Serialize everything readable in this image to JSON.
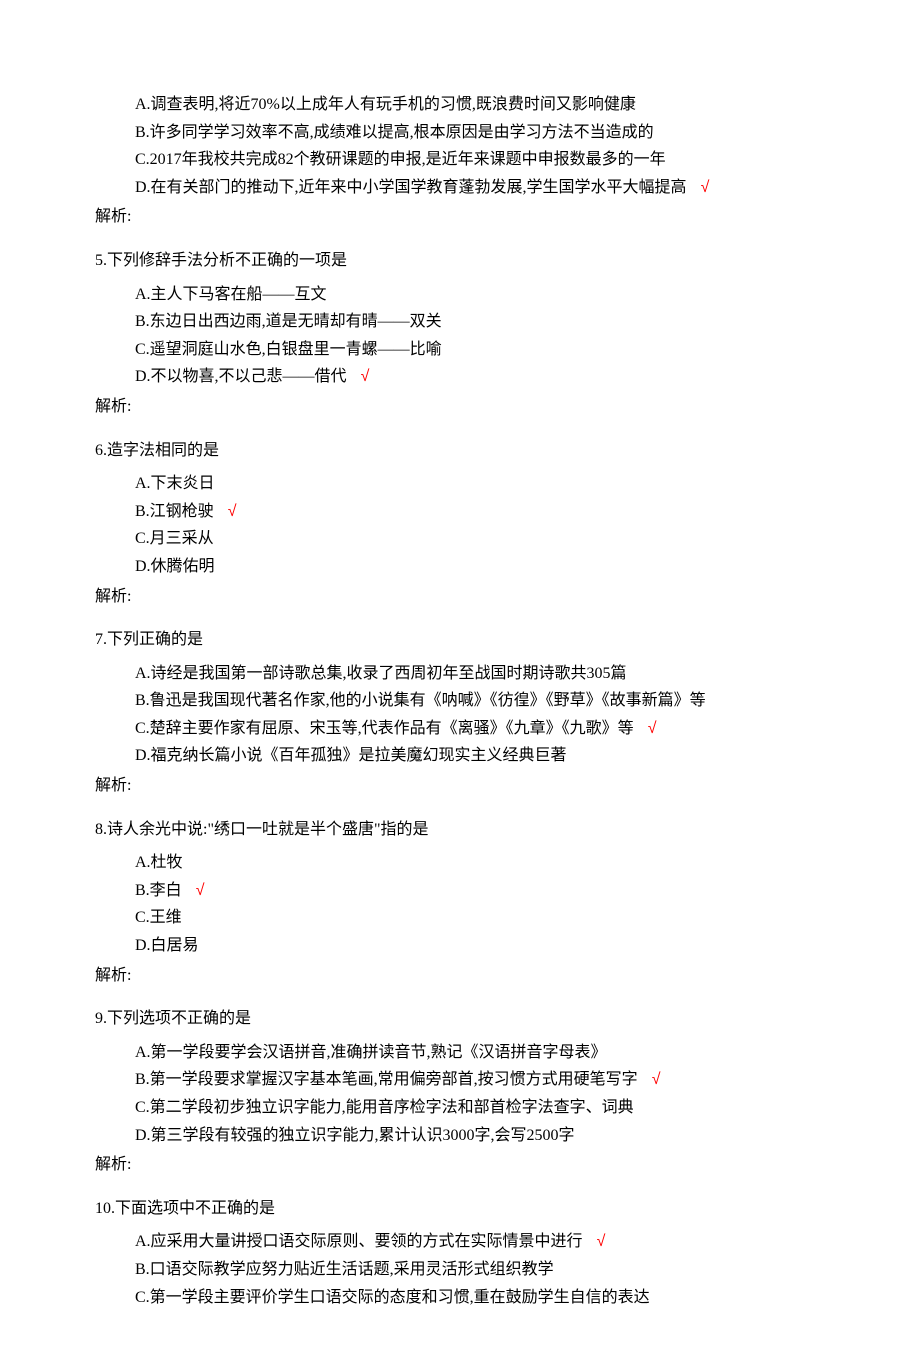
{
  "questions": [
    {
      "stem": "",
      "options": [
        {
          "label": "A.调查表明,将近70%以上成年人有玩手机的习惯,既浪费时间又影响健康",
          "correct": false
        },
        {
          "label": "B.许多同学学习效率不高,成绩难以提高,根本原因是由学习方法不当造成的",
          "correct": false
        },
        {
          "label": "C.2017年我校共完成82个教研课题的申报,是近年来课题中申报数最多的一年",
          "correct": false
        },
        {
          "label": "D.在有关部门的推动下,近年来中小学国学教育蓬勃发展,学生国学水平大幅提高",
          "correct": true
        }
      ],
      "analysis": "解析:"
    },
    {
      "stem": "5.下列修辞手法分析不正确的一项是",
      "options": [
        {
          "label": "A.主人下马客在船——互文",
          "correct": false
        },
        {
          "label": "B.东边日出西边雨,道是无晴却有晴——双关",
          "correct": false
        },
        {
          "label": "C.遥望洞庭山水色,白银盘里一青螺——比喻",
          "correct": false
        },
        {
          "label": "D.不以物喜,不以己悲——借代",
          "correct": true
        }
      ],
      "analysis": "解析:"
    },
    {
      "stem": "6.造字法相同的是",
      "options": [
        {
          "label": "A.下末炎日",
          "correct": false
        },
        {
          "label": "B.江钢枪驶",
          "correct": true
        },
        {
          "label": "C.月三采从",
          "correct": false
        },
        {
          "label": "D.休腾佑明",
          "correct": false
        }
      ],
      "analysis": "解析:"
    },
    {
      "stem": "7.下列正确的是",
      "options": [
        {
          "label": "A.诗经是我国第一部诗歌总集,收录了西周初年至战国时期诗歌共305篇",
          "correct": false
        },
        {
          "label": "B.鲁迅是我国现代著名作家,他的小说集有《呐喊》《彷徨》《野草》《故事新篇》等",
          "correct": false
        },
        {
          "label": "C.楚辞主要作家有屈原、宋玉等,代表作品有《离骚》《九章》《九歌》等",
          "correct": true
        },
        {
          "label": "D.福克纳长篇小说《百年孤独》是拉美魔幻现实主义经典巨著",
          "correct": false
        }
      ],
      "analysis": "解析:"
    },
    {
      "stem": "8.诗人余光中说:\"绣口一吐就是半个盛唐\"指的是",
      "options": [
        {
          "label": "A.杜牧",
          "correct": false
        },
        {
          "label": "B.李白",
          "correct": true
        },
        {
          "label": "C.王维",
          "correct": false
        },
        {
          "label": "D.白居易",
          "correct": false
        }
      ],
      "analysis": "解析:"
    },
    {
      "stem": "9.下列选项不正确的是",
      "options": [
        {
          "label": "A.第一学段要学会汉语拼音,准确拼读音节,熟记《汉语拼音字母表》",
          "correct": false
        },
        {
          "label": "B.第一学段要求掌握汉字基本笔画,常用偏旁部首,按习惯方式用硬笔写字",
          "correct": true
        },
        {
          "label": "C.第二学段初步独立识字能力,能用音序检字法和部首检字法查字、词典",
          "correct": false
        },
        {
          "label": "D.第三学段有较强的独立识字能力,累计认识3000字,会写2500字",
          "correct": false
        }
      ],
      "analysis": "解析:"
    },
    {
      "stem": "10.下面选项中不正确的是",
      "options": [
        {
          "label": "A.应采用大量讲授口语交际原则、要领的方式在实际情景中进行",
          "correct": true
        },
        {
          "label": "B.口语交际教学应努力贴近生活话题,采用灵活形式组织教学",
          "correct": false
        },
        {
          "label": "C.第一学段主要评价学生口语交际的态度和习惯,重在鼓励学生自信的表达",
          "correct": false
        }
      ],
      "analysis": ""
    }
  ],
  "checkmark": "√"
}
